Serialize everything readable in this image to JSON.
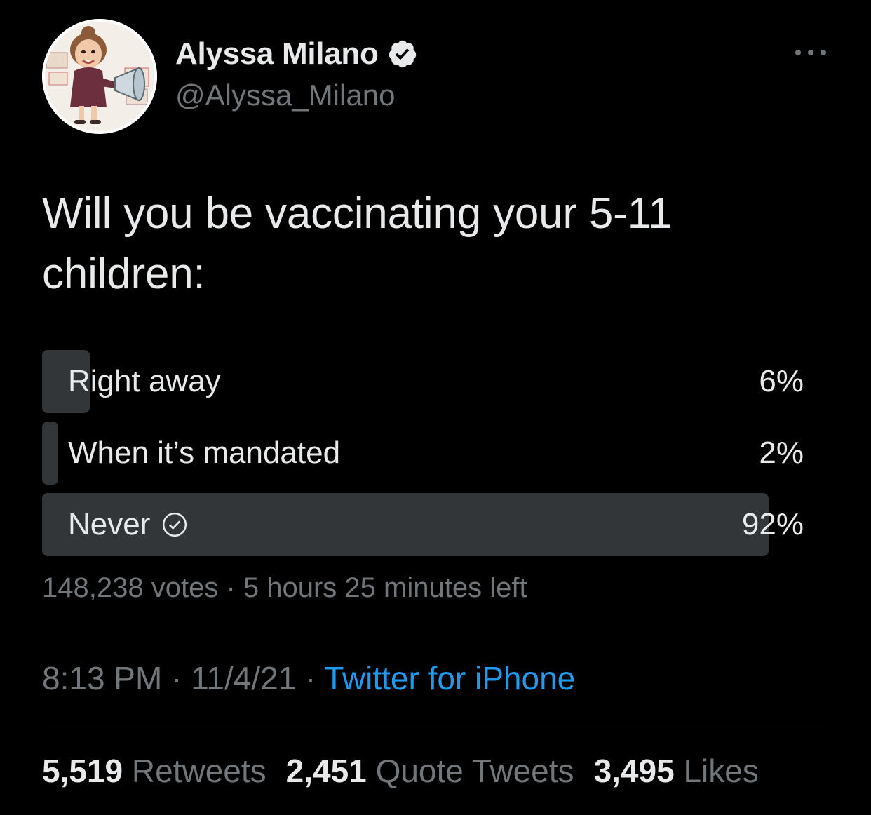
{
  "author": {
    "display_name": "Alyssa Milano",
    "handle": "@Alyssa_Milano",
    "verified": true,
    "avatar_icon": "caricature-avatar-with-megaphone"
  },
  "tweet": {
    "text": "Will you be vaccinating your 5-11 children:"
  },
  "poll": {
    "options": [
      {
        "label": "Right away",
        "percent_label": "6%",
        "percent": 6
      },
      {
        "label": "When it’s mandated",
        "percent_label": "2%",
        "percent": 2
      },
      {
        "label": "Never",
        "percent_label": "92%",
        "percent": 92,
        "winner": true
      }
    ],
    "votes": "148,238 votes",
    "separator": "·",
    "time_left": "5 hours 25 minutes left"
  },
  "meta": {
    "time": "8:13 PM",
    "separator": "·",
    "date": "11/4/21",
    "source": "Twitter for iPhone"
  },
  "stats": {
    "retweets_count": "5,519",
    "retweets_label": "Retweets",
    "quotes_count": "2,451",
    "quotes_label": "Quote Tweets",
    "likes_count": "3,495",
    "likes_label": "Likes"
  },
  "colors": {
    "background": "#000000",
    "text": "#e7e9ea",
    "secondary_text": "#71767b",
    "link": "#1d9bf0",
    "poll_bar": "#333639",
    "divider": "#2f3336"
  }
}
